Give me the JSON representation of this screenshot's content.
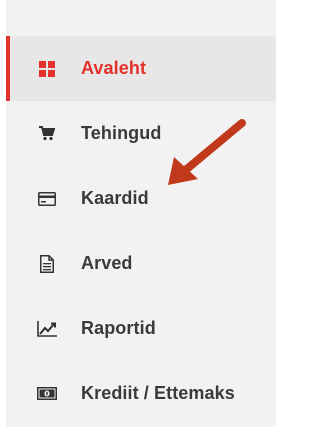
{
  "sidebar": {
    "items": [
      {
        "label": "Avaleht",
        "icon": "dashboard-grid-icon",
        "active": true
      },
      {
        "label": "Tehingud",
        "icon": "cart-icon",
        "active": false
      },
      {
        "label": "Kaardid",
        "icon": "credit-card-icon",
        "active": false
      },
      {
        "label": "Arved",
        "icon": "document-icon",
        "active": false
      },
      {
        "label": "Raportid",
        "icon": "line-chart-icon",
        "active": false
      },
      {
        "label": "Krediit / Ettemaks",
        "icon": "money-icon",
        "active": false
      }
    ]
  },
  "colors": {
    "accent": "#e4312b",
    "panel_bg": "#f2f2f2",
    "active_bg": "#e7e7e7",
    "text": "#3a3a3a",
    "annotation_arrow": "#c0391b"
  }
}
